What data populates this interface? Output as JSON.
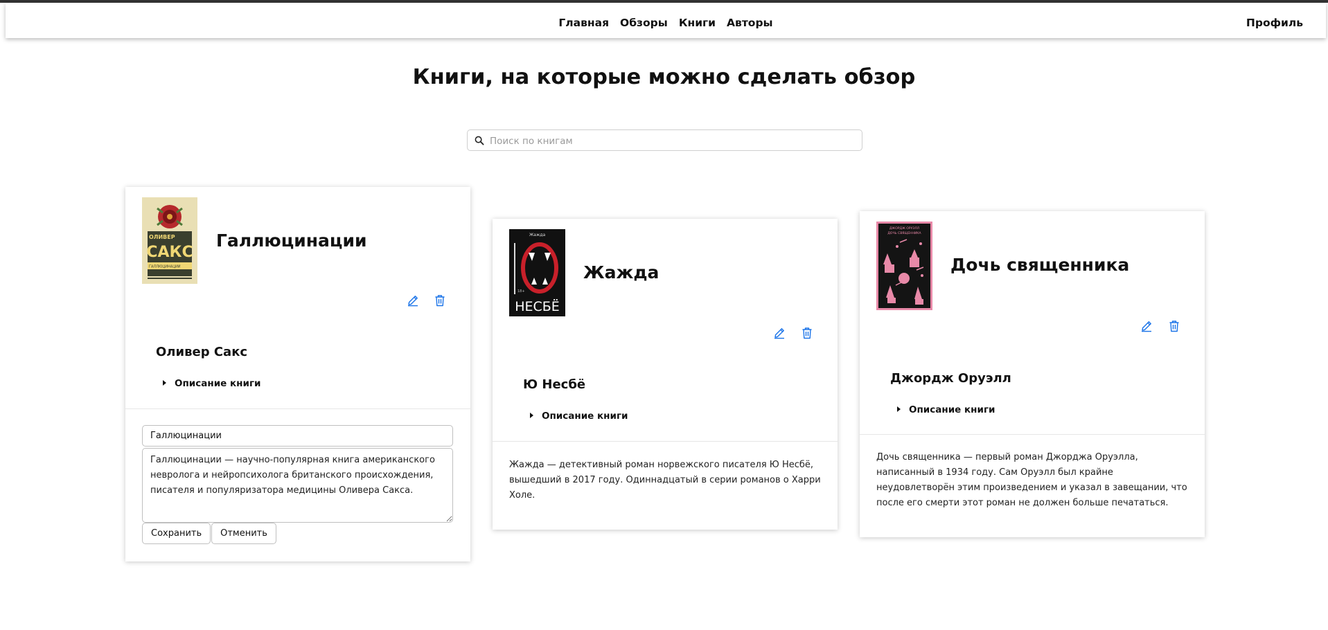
{
  "nav": {
    "links": [
      "Главная",
      "Обзоры",
      "Книги",
      "Авторы"
    ],
    "profile": "Профиль"
  },
  "page": {
    "title": "Книги, на которые можно сделать обзор"
  },
  "search": {
    "placeholder": "Поиск по книгам",
    "value": ""
  },
  "books": [
    {
      "title": "Галлюцинации",
      "author": "Оливер Сакс",
      "summary_label": "Описание книги",
      "cover": {
        "author_text": "ОЛИВЕР",
        "big_text": "САКС",
        "subtitle": "ГАЛЛЮЦИНАЦИИ",
        "bg": "#e9dfb4",
        "accent": "#b5292c"
      },
      "edit": {
        "title_value": "Галлюцинации",
        "description_value": "Галлюцинации — научно-популярная книга американского невролога и нейропсихолога британского происхождения, писателя и популяризатора медицины Оливера Сакса.",
        "save_label": "Сохранить",
        "cancel_label": "Отменить"
      }
    },
    {
      "title": "Жажда",
      "author": "Ю Несбё",
      "summary_label": "Описание книги",
      "cover": {
        "top_text": "Жажда",
        "age": "18+",
        "big_text": "НЕСБЁ",
        "bg": "#111111",
        "accent": "#c8202a"
      },
      "description": "Жажда — детективный роман норвежского писателя Ю Несбё, вышедший в 2017 году. Одиннадцатый в серии романов о Харри Холе."
    },
    {
      "title": "Дочь священника",
      "author": "Джордж Оруэлл",
      "summary_label": "Описание книги",
      "cover": {
        "author_text": "ДЖОРДЖ ОРУЭЛЛ",
        "title_text": "ДОЧЬ СВЯЩЕННИКА",
        "bg": "#141414",
        "accent": "#e889a8"
      },
      "description": "Дочь священника — первый роман Джорджа Оруэлла, написанный в 1934 году. Сам Оруэлл был крайне неудовлетворён этим произведением и указал в завещании, что после его смерти этот роман не должен больше печататься."
    }
  ],
  "colors": {
    "icon_blue": "#1a73e8",
    "top_line": "#333333"
  }
}
